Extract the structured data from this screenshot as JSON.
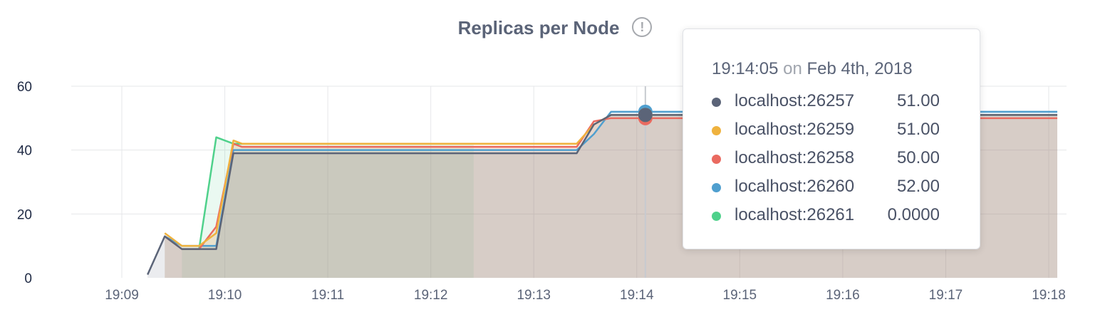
{
  "chart_data": {
    "type": "area",
    "title": "Replicas per Node",
    "ylim": [
      0,
      60
    ],
    "yticks": [
      0,
      20,
      40,
      60
    ],
    "xticks": [
      "19:09",
      "19:10",
      "19:11",
      "19:12",
      "19:13",
      "19:14",
      "19:15",
      "19:16",
      "19:17",
      "19:18"
    ],
    "grid": true,
    "series": [
      {
        "name": "localhost:26257",
        "color": "#5b6478",
        "x": [
          "19:09:15",
          "19:09:25",
          "19:09:35",
          "19:09:45",
          "19:09:55",
          "19:10:05",
          "19:10:10",
          "19:12:25",
          "19:13:25",
          "19:13:35",
          "19:13:45",
          "19:14:05",
          "19:18:05"
        ],
        "y": [
          1,
          13,
          9,
          9,
          9,
          39,
          39,
          39,
          39,
          48,
          51,
          51,
          51
        ]
      },
      {
        "name": "localhost:26259",
        "color": "#efb23e",
        "x": [
          "19:09:25",
          "19:09:35",
          "19:09:45",
          "19:09:55",
          "19:10:05",
          "19:10:10",
          "19:12:25",
          "19:13:25",
          "19:13:35",
          "19:13:45",
          "19:14:05",
          "19:18:05"
        ],
        "y": [
          14,
          10,
          10,
          14,
          43,
          42,
          42,
          42,
          48,
          51,
          51,
          51
        ]
      },
      {
        "name": "localhost:26258",
        "color": "#ea6a60",
        "x": [
          "19:09:25",
          "19:09:35",
          "19:09:45",
          "19:09:55",
          "19:10:05",
          "19:10:10",
          "19:12:25",
          "19:13:25",
          "19:13:35",
          "19:13:45",
          "19:14:05",
          "19:18:05"
        ],
        "y": [
          13,
          9,
          9,
          16,
          42,
          41,
          41,
          41,
          49,
          50,
          50,
          50
        ]
      },
      {
        "name": "localhost:26260",
        "color": "#4f9fcf",
        "x": [
          "19:09:25",
          "19:09:35",
          "19:09:45",
          "19:09:55",
          "19:10:05",
          "19:10:10",
          "19:12:25",
          "19:13:25",
          "19:13:35",
          "19:13:45",
          "19:14:05",
          "19:18:05"
        ],
        "y": [
          13,
          10,
          10,
          10,
          40,
          40,
          40,
          40,
          45,
          52,
          52,
          52
        ]
      },
      {
        "name": "localhost:26261",
        "color": "#4fd18b",
        "x": [
          "19:09:35",
          "19:09:45",
          "19:09:55",
          "19:10:05",
          "19:10:10",
          "19:12:25"
        ],
        "y": [
          9,
          9,
          44,
          42,
          42,
          42
        ]
      }
    ]
  },
  "tooltip": {
    "time": "19:14:05",
    "on": "on",
    "date": "Feb 4th, 2018",
    "rows": [
      {
        "name": "localhost:26257",
        "value": "51.00",
        "color": "#5b6478"
      },
      {
        "name": "localhost:26259",
        "value": "51.00",
        "color": "#efb23e"
      },
      {
        "name": "localhost:26258",
        "value": "50.00",
        "color": "#ea6a60"
      },
      {
        "name": "localhost:26260",
        "value": "52.00",
        "color": "#4f9fcf"
      },
      {
        "name": "localhost:26261",
        "value": "0.0000",
        "color": "#4fd18b"
      }
    ]
  }
}
